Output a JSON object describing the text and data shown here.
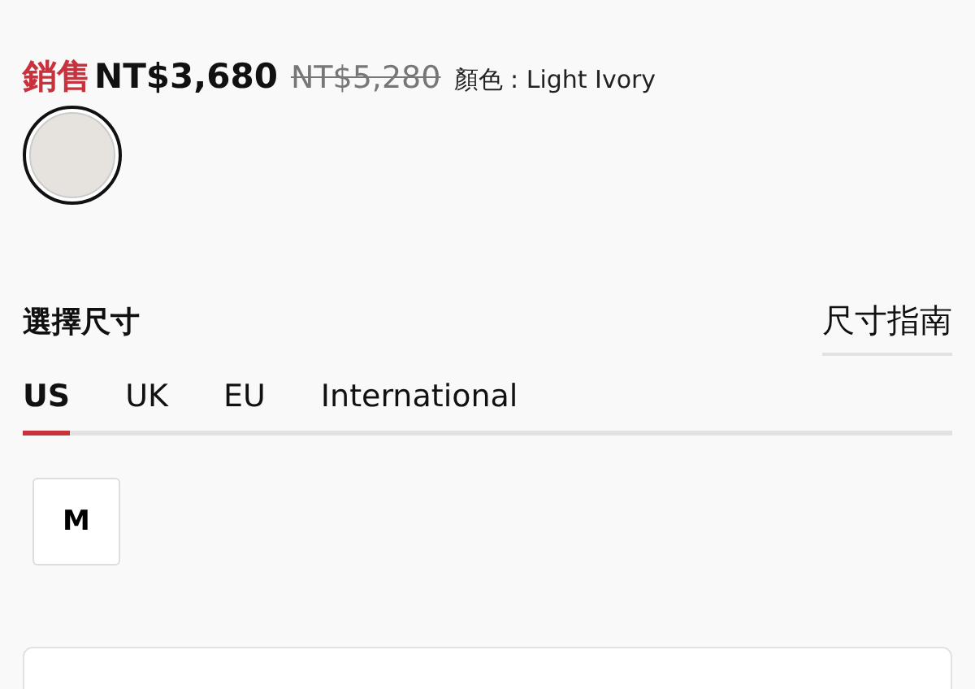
{
  "price": {
    "sale_label": "銷售",
    "sale_price": "NT$3,680",
    "original_price": "NT$5,280",
    "color_label": "顏色 : Light Ivory"
  },
  "swatches": [
    {
      "selected": true
    }
  ],
  "size_section": {
    "title": "選擇尺寸",
    "guide_link": "尺寸指南"
  },
  "tabs": [
    {
      "label": "US",
      "selected": true
    },
    {
      "label": "UK",
      "selected": false
    },
    {
      "label": "EU",
      "selected": false
    },
    {
      "label": "International",
      "selected": false
    }
  ],
  "sizes": [
    {
      "label": "M"
    }
  ]
}
